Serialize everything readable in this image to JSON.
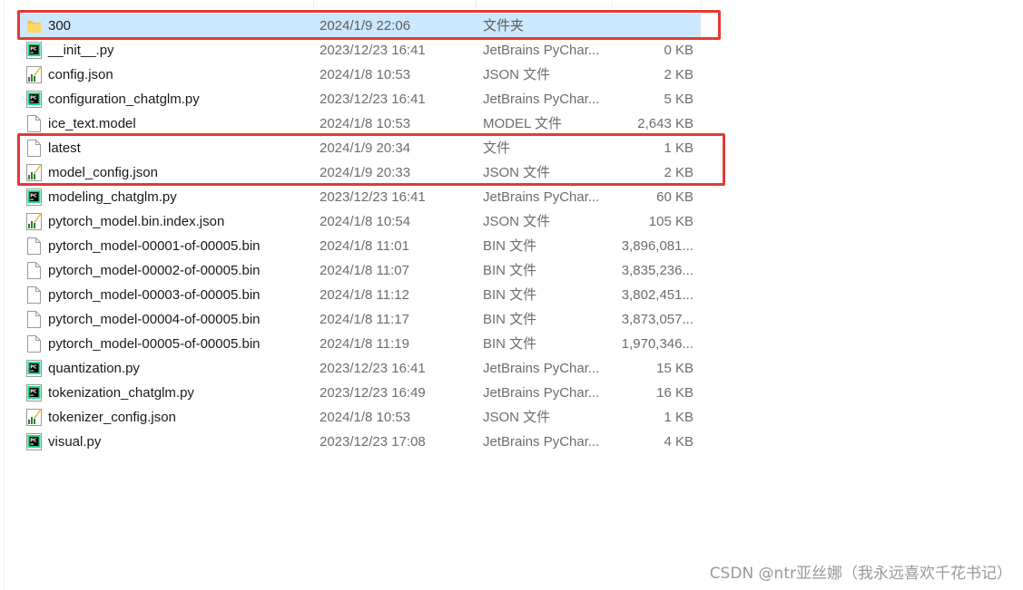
{
  "files": [
    {
      "icon": "folder-icon",
      "name": "300",
      "date": "2024/1/9 22:06",
      "type": "文件夹",
      "size": ""
    },
    {
      "icon": "pycharm-file-icon",
      "name": "__init__.py",
      "date": "2023/12/23 16:41",
      "type": "JetBrains PyChar...",
      "size": "0 KB"
    },
    {
      "icon": "json-file-icon",
      "name": "config.json",
      "date": "2024/1/8 10:53",
      "type": "JSON 文件",
      "size": "2 KB"
    },
    {
      "icon": "pycharm-file-icon",
      "name": "configuration_chatglm.py",
      "date": "2023/12/23 16:41",
      "type": "JetBrains PyChar...",
      "size": "5 KB"
    },
    {
      "icon": "blank-file-icon",
      "name": "ice_text.model",
      "date": "2024/1/8 10:53",
      "type": "MODEL 文件",
      "size": "2,643 KB"
    },
    {
      "icon": "blank-file-icon",
      "name": "latest",
      "date": "2024/1/9 20:34",
      "type": "文件",
      "size": "1 KB"
    },
    {
      "icon": "json-file-icon",
      "name": "model_config.json",
      "date": "2024/1/9 20:33",
      "type": "JSON 文件",
      "size": "2 KB"
    },
    {
      "icon": "pycharm-file-icon",
      "name": "modeling_chatglm.py",
      "date": "2023/12/23 16:41",
      "type": "JetBrains PyChar...",
      "size": "60 KB"
    },
    {
      "icon": "json-file-icon",
      "name": "pytorch_model.bin.index.json",
      "date": "2024/1/8 10:54",
      "type": "JSON 文件",
      "size": "105 KB"
    },
    {
      "icon": "blank-file-icon",
      "name": "pytorch_model-00001-of-00005.bin",
      "date": "2024/1/8 11:01",
      "type": "BIN 文件",
      "size": "3,896,081..."
    },
    {
      "icon": "blank-file-icon",
      "name": "pytorch_model-00002-of-00005.bin",
      "date": "2024/1/8 11:07",
      "type": "BIN 文件",
      "size": "3,835,236..."
    },
    {
      "icon": "blank-file-icon",
      "name": "pytorch_model-00003-of-00005.bin",
      "date": "2024/1/8 11:12",
      "type": "BIN 文件",
      "size": "3,802,451..."
    },
    {
      "icon": "blank-file-icon",
      "name": "pytorch_model-00004-of-00005.bin",
      "date": "2024/1/8 11:17",
      "type": "BIN 文件",
      "size": "3,873,057..."
    },
    {
      "icon": "blank-file-icon",
      "name": "pytorch_model-00005-of-00005.bin",
      "date": "2024/1/8 11:19",
      "type": "BIN 文件",
      "size": "1,970,346..."
    },
    {
      "icon": "pycharm-file-icon",
      "name": "quantization.py",
      "date": "2023/12/23 16:41",
      "type": "JetBrains PyChar...",
      "size": "15 KB"
    },
    {
      "icon": "pycharm-file-icon",
      "name": "tokenization_chatglm.py",
      "date": "2023/12/23 16:49",
      "type": "JetBrains PyChar...",
      "size": "16 KB"
    },
    {
      "icon": "json-file-icon",
      "name": "tokenizer_config.json",
      "date": "2024/1/8 10:53",
      "type": "JSON 文件",
      "size": "1 KB"
    },
    {
      "icon": "pycharm-file-icon",
      "name": "visual.py",
      "date": "2023/12/23 17:08",
      "type": "JetBrains PyChar...",
      "size": "4 KB"
    }
  ],
  "selected_index": 0,
  "watermark": "CSDN @ntr亚丝娜（我永远喜欢千花书记）",
  "colors": {
    "selection": "#cce8ff",
    "highlight_border": "#e53935",
    "folder": "#f5c342",
    "pycharm_green": "#21d789"
  }
}
